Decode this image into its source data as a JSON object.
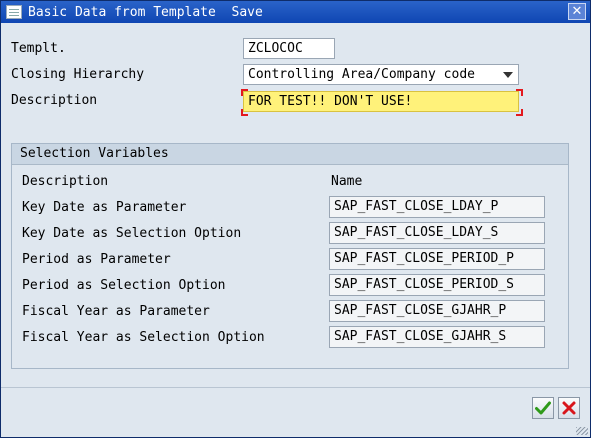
{
  "window": {
    "title": "Basic Data from Template  Save",
    "close_symbol": "✕"
  },
  "header": {
    "template_label": "Templt.",
    "template_value": "ZCLOCOC",
    "hierarchy_label": "Closing Hierarchy",
    "hierarchy_value": "Controlling Area/Company code",
    "description_label": "Description",
    "description_value": "FOR TEST!! DON'T USE!"
  },
  "selection_variables": {
    "title": "Selection Variables",
    "col_description": "Description",
    "col_name": "Name",
    "rows": [
      {
        "description": "Key Date as Parameter",
        "name": "SAP_FAST_CLOSE_LDAY_P"
      },
      {
        "description": "Key Date as Selection Option",
        "name": "SAP_FAST_CLOSE_LDAY_S"
      },
      {
        "description": "Period as Parameter",
        "name": "SAP_FAST_CLOSE_PERIOD_P"
      },
      {
        "description": "Period as Selection Option",
        "name": "SAP_FAST_CLOSE_PERIOD_S"
      },
      {
        "description": "Fiscal Year as Parameter",
        "name": "SAP_FAST_CLOSE_GJAHR_P"
      },
      {
        "description": "Fiscal Year as Selection Option",
        "name": "SAP_FAST_CLOSE_GJAHR_S"
      }
    ]
  },
  "icons": {
    "title": "window-icon",
    "confirm": "checkmark-icon",
    "cancel": "cross-icon"
  },
  "colors": {
    "titlebar": "#1f56bf",
    "required_field": "#fff27a",
    "confirm_green": "#2f9a1a",
    "cancel_red": "#d8151b"
  }
}
